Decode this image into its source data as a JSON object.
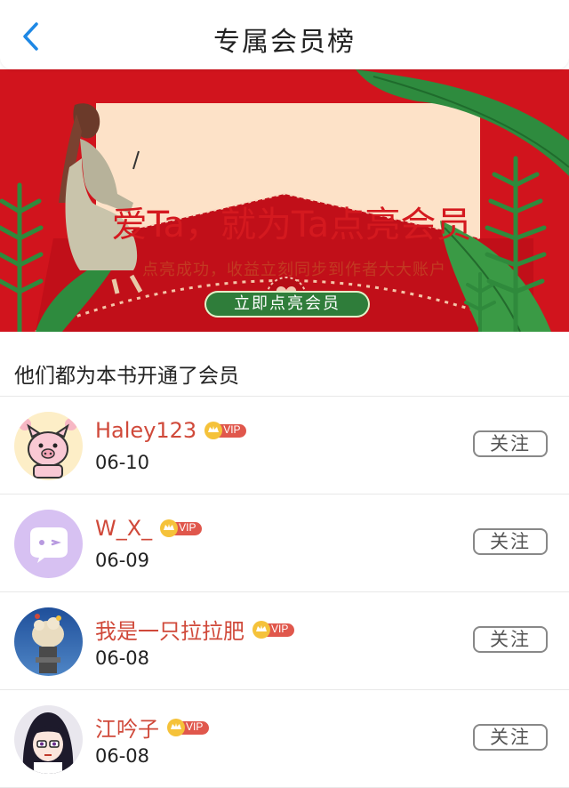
{
  "nav": {
    "title": "专属会员榜"
  },
  "banner": {
    "title": "爱Ta，就为Ta点亮会员",
    "subtitle": "点亮成功，收益立刻同步到作者大大账户",
    "button_label": "立即点亮会员"
  },
  "section": {
    "header": "他们都为本书开通了会员"
  },
  "members": [
    {
      "name": "Haley123",
      "date": "06-10",
      "badge": "VIP",
      "follow_label": "关注",
      "avatar": "pig-avatar"
    },
    {
      "name": "W_X_",
      "date": "06-09",
      "badge": "VIP",
      "follow_label": "关注",
      "avatar": "chat-bubble-avatar"
    },
    {
      "name": "我是一只拉拉肥",
      "date": "06-08",
      "badge": "VIP",
      "follow_label": "关注",
      "avatar": "balloon-photo-avatar"
    },
    {
      "name": "江吟子",
      "date": "06-08",
      "badge": "VIP",
      "follow_label": "关注",
      "avatar": "anime-girl-avatar"
    }
  ],
  "colors": {
    "accent_blue": "#1e88e5",
    "banner_red": "#d1141d",
    "name_red": "#d0493a",
    "vip_red": "#e0574c"
  }
}
